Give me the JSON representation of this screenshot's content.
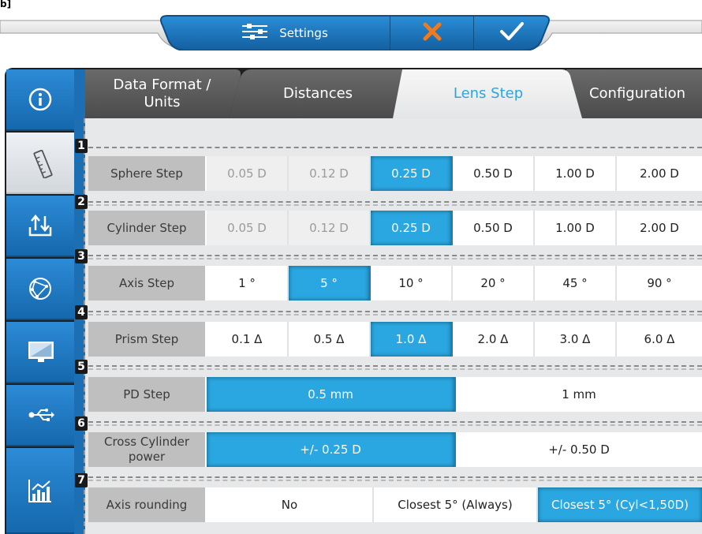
{
  "corner_mark": "b]",
  "toolbar": {
    "settings_label": "Settings",
    "settings_icon": "sliders-icon",
    "cancel_icon": "close-x-icon",
    "confirm_icon": "checkmark-icon",
    "accent": "#1f78c1",
    "cancel_color": "#f07a1c"
  },
  "sidebar": {
    "items": [
      {
        "name": "info",
        "icon": "info-icon"
      },
      {
        "name": "ruler",
        "icon": "ruler-icon",
        "active": true
      },
      {
        "name": "import-export",
        "icon": "upload-download-icon"
      },
      {
        "name": "network",
        "icon": "network-globe-icon"
      },
      {
        "name": "display",
        "icon": "monitor-icon"
      },
      {
        "name": "usb",
        "icon": "usb-icon"
      },
      {
        "name": "statistics",
        "icon": "chart-icon"
      }
    ]
  },
  "tabs": [
    {
      "label_line1": "Data Format /",
      "label_line2": "Units"
    },
    {
      "label": "Distances"
    },
    {
      "label": "Lens Step",
      "active": true
    },
    {
      "label": "Configuration"
    }
  ],
  "settings": {
    "row1": {
      "number": "1",
      "label": "Sphere Step",
      "options": [
        "0.05 D",
        "0.12 D",
        "0.25 D",
        "0.50 D",
        "1.00 D",
        "2.00 D"
      ],
      "selected": "0.25 D"
    },
    "row2": {
      "number": "2",
      "label": "Cylinder Step",
      "options": [
        "0.05 D",
        "0.12 D",
        "0.25 D",
        "0.50 D",
        "1.00 D",
        "2.00 D"
      ],
      "selected": "0.25 D"
    },
    "row3": {
      "number": "3",
      "label": "Axis Step",
      "options": [
        "1 °",
        "5 °",
        "10 °",
        "20 °",
        "45 °",
        "90 °"
      ],
      "selected": "5 °"
    },
    "row4": {
      "number": "4",
      "label": "Prism Step",
      "options": [
        "0.1 Δ",
        "0.5 Δ",
        "1.0 Δ",
        "2.0 Δ",
        "3.0 Δ",
        "6.0 Δ"
      ],
      "selected": "1.0 Δ"
    },
    "row5": {
      "number": "5",
      "label": "PD Step",
      "options": [
        "0.5 mm",
        "1 mm"
      ],
      "selected": "0.5 mm"
    },
    "row6": {
      "number": "6",
      "label_line1": "Cross Cylinder",
      "label_line2": "power",
      "options": [
        "+/- 0.25 D",
        "+/- 0.50 D"
      ],
      "selected": "+/- 0.25 D"
    },
    "row7": {
      "number": "7",
      "label": "Axis rounding",
      "options": [
        "No",
        "Closest 5° (Always)",
        "Closest 5° (Cyl<1,50D)"
      ],
      "selected": "Closest 5° (Cyl<1,50D)"
    }
  },
  "colors": {
    "selected": "#2aa6e0",
    "sidebar": "#1f78c1",
    "label_bg": "#bfbfbf"
  }
}
